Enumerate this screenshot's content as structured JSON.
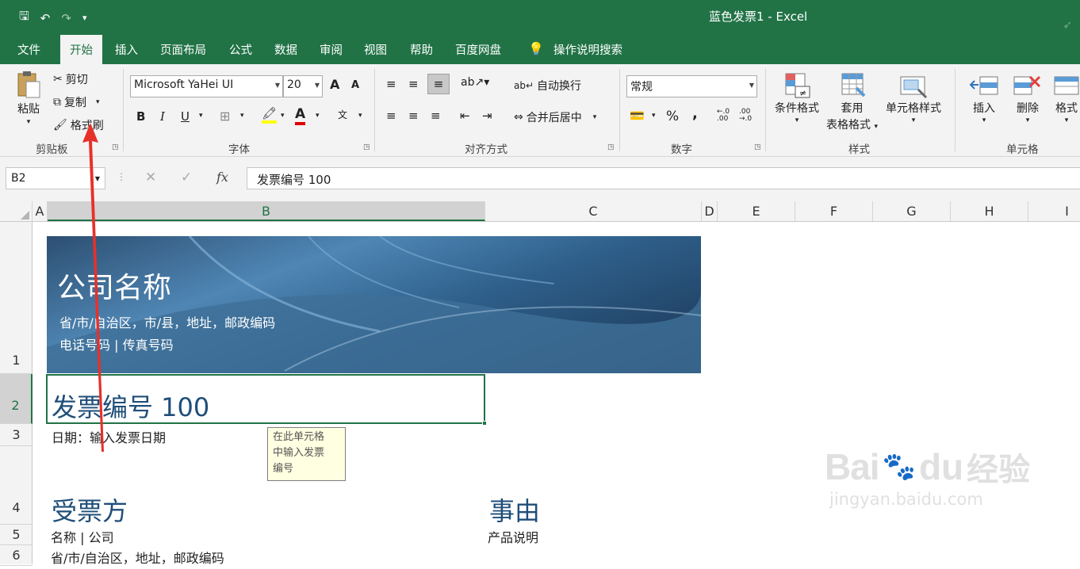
{
  "window": {
    "title": "蓝色发票1  -  Excel"
  },
  "qat": {
    "save": "🖫",
    "undo": "↶",
    "redo": "↷",
    "customize": "▾"
  },
  "tabs": [
    {
      "label": "文件"
    },
    {
      "label": "开始"
    },
    {
      "label": "插入"
    },
    {
      "label": "页面布局"
    },
    {
      "label": "公式"
    },
    {
      "label": "数据"
    },
    {
      "label": "审阅"
    },
    {
      "label": "视图"
    },
    {
      "label": "帮助"
    },
    {
      "label": "百度网盘"
    }
  ],
  "tell_me": "操作说明搜索",
  "clipboard": {
    "group": "剪贴板",
    "paste": "粘贴",
    "cut": "剪切",
    "copy": "复制",
    "format_painter": "格式刷"
  },
  "font": {
    "group": "字体",
    "name": "Microsoft YaHei UI",
    "size": "20",
    "grow": "A",
    "shrink": "A",
    "bold": "B",
    "italic": "I",
    "underline": "U",
    "font_color_glyph": "A",
    "phonetic_glyph": "文"
  },
  "alignment": {
    "group": "对齐方式",
    "wrap": "自动换行",
    "merge": "合并后居中"
  },
  "number": {
    "group": "数字",
    "format": "常规",
    "percent": "%",
    "comma": ",",
    "inc_decimal": "←.0\n.00",
    "dec_decimal": ".00\n→.0"
  },
  "styles": {
    "group": "样式",
    "conditional": "条件格式",
    "table_line1": "套用",
    "table_line2": "表格格式",
    "cell_styles": "单元格样式"
  },
  "cells": {
    "group": "单元格",
    "insert": "插入",
    "delete": "删除",
    "format": "格式"
  },
  "formula_bar": {
    "name_box": "B2",
    "fx": "fx",
    "content": "发票编号 100"
  },
  "columns": [
    "A",
    "B",
    "C",
    "D",
    "E",
    "F",
    "G",
    "H",
    "I"
  ],
  "rows": [
    "1",
    "2",
    "3",
    "4",
    "5",
    "6"
  ],
  "sheet": {
    "company": "公司名称",
    "address": "省/市/自治区，市/县，地址，邮政编码",
    "phone": "电话号码 | 传真号码",
    "invoice": "发票编号 100",
    "date": "日期：输入发票日期",
    "recipient": "受票方",
    "reason": "事由",
    "name_company": "名称 | 公司",
    "product": "产品说明",
    "recipient_addr": "省/市/自治区，地址，邮政编码"
  },
  "tooltip": {
    "line1": "在此单元格",
    "line2": "中输入发票",
    "line3": "编号"
  },
  "watermark": {
    "brand": "Bai",
    "brand2": "du",
    "cn": "经验",
    "url": "jingyan.baidu.com"
  },
  "colors": {
    "excel_green": "#217346",
    "title_blue": "#1f4e79",
    "annotation_red": "#e8302a"
  }
}
